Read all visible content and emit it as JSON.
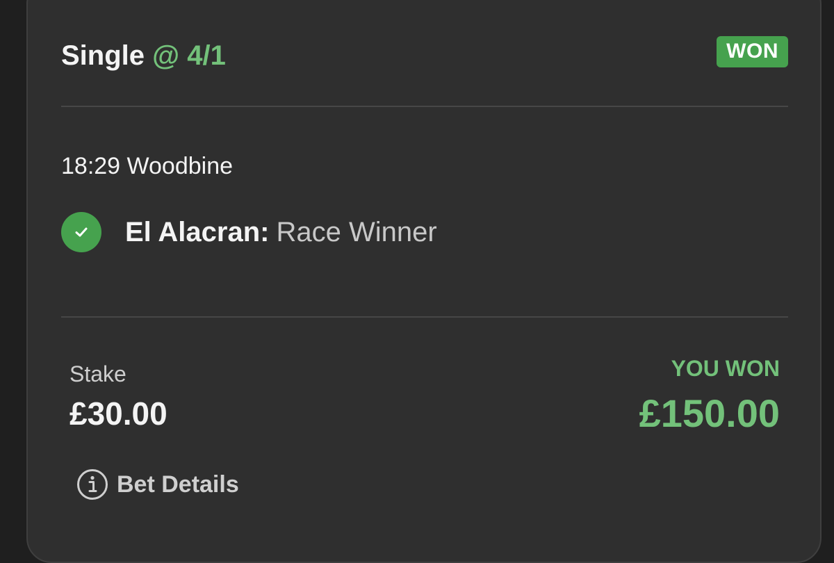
{
  "bet": {
    "type": "Single",
    "odds": "@ 4/1",
    "status": "WON"
  },
  "event": {
    "time_venue": "18:29 Woodbine"
  },
  "selection": {
    "name": "El Alacran:",
    "market": "Race Winner",
    "result_icon": "check-icon"
  },
  "stake": {
    "label": "Stake",
    "value": "£30.00"
  },
  "returns": {
    "label": "YOU WON",
    "value": "£150.00"
  },
  "actions": {
    "details_label": "Bet Details",
    "details_icon": "info-icon"
  },
  "colors": {
    "accent_green": "#73c17a",
    "badge_green": "#46a24e",
    "card_bg": "#2f2f2f"
  }
}
